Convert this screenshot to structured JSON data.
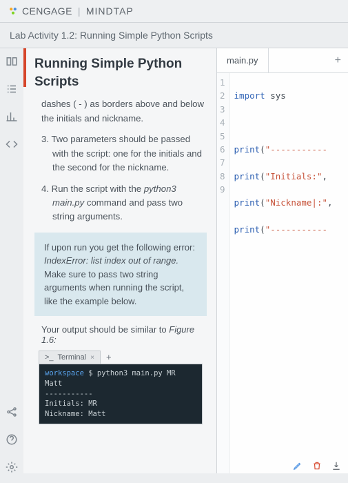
{
  "brand": {
    "name1": "CENGAGE",
    "name2": "MINDTAP",
    "sep": "|"
  },
  "subtitle": "Lab Activity 1.2: Running Simple Python Scripts",
  "lesson": {
    "title": "Running Simple Python Scripts",
    "step2_cont": "dashes ( - ) as borders above and below the initials and nickname.",
    "step3_num": "3.",
    "step3": "Two parameters should be passed with the script: one for the initials and the second for the nickname.",
    "step4_num": "4.",
    "step4_a": "Run the script with the ",
    "step4_cmd": "python3 main.py",
    "step4_b": " command and pass two string arguments.",
    "note_a": "If upon run you get the following error: ",
    "note_err": "IndexError: list index out of range.",
    "note_b": " Make sure to pass two string arguments when running the script, like the example below.",
    "out_a": "Your output should be similar to ",
    "out_fig": "Figure 1.6:"
  },
  "terminal": {
    "tab": "Terminal",
    "prompt_sym": ">_",
    "close": "×",
    "add": "+",
    "ws": "workspace",
    "dollar": "$",
    "cmd": "python3 main.py MR Matt",
    "dashline": "-----------",
    "l1": "Initials:  MR",
    "l2": "Nickname:  Matt"
  },
  "editor": {
    "filename": "main.py",
    "plus": "+",
    "lines": {
      "n1": "1",
      "n2": "2",
      "n3": "3",
      "n4": "4",
      "n5": "5",
      "n6": "6",
      "n7": "7",
      "n8": "8",
      "n9": "9"
    },
    "code": {
      "l1_kw": "import",
      "l1_rest": " sys",
      "l3_fn": "print",
      "l3_str": "\"-----------",
      "l4_fn": "print",
      "l4_str": "\"Initials:\"",
      "l4_tail": ",",
      "l5_fn": "print",
      "l5_str": "\"Nickname|:\"",
      "l5_tail": ",",
      "l6_fn": "print",
      "l6_str": "\"-----------"
    }
  },
  "icons": {
    "book": "book-icon",
    "list": "list-icon",
    "chart": "chart-icon",
    "code": "code-icon",
    "share": "share-icon",
    "help": "help-icon",
    "gear": "gear-icon",
    "pencil": "pencil-icon",
    "trash": "trash-icon",
    "download": "download-icon"
  }
}
